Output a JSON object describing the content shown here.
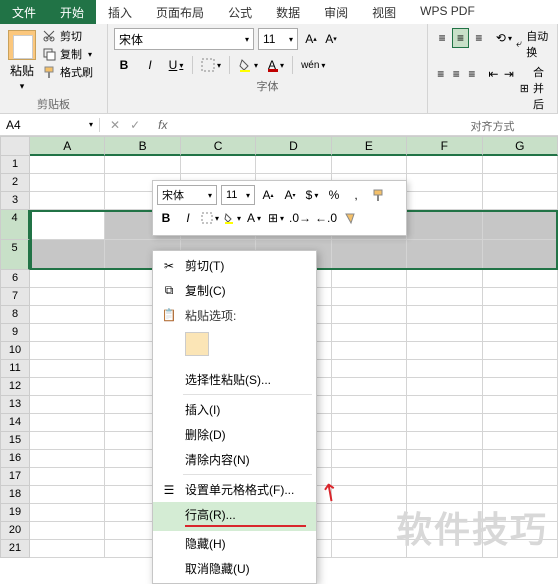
{
  "tabs": {
    "file": "文件",
    "home": "开始",
    "insert": "插入",
    "layout": "页面布局",
    "formula": "公式",
    "data": "数据",
    "review": "审阅",
    "view": "视图",
    "wps": "WPS PDF"
  },
  "clipboard": {
    "paste": "粘贴",
    "cut": "剪切",
    "copy": "复制",
    "format_painter": "格式刷",
    "group": "剪贴板"
  },
  "font": {
    "name": "宋体",
    "size": "11",
    "bold": "B",
    "italic": "I",
    "underline": "U",
    "wen": "wén",
    "group": "字体"
  },
  "align": {
    "auto_wrap": "自动换",
    "merge": "合并后",
    "group": "对齐方式"
  },
  "namebox": "A4",
  "columns": [
    "A",
    "B",
    "C",
    "D",
    "E",
    "F",
    "G"
  ],
  "rows": [
    "1",
    "2",
    "3",
    "4",
    "5",
    "6",
    "7",
    "8",
    "9",
    "10",
    "11",
    "12",
    "13",
    "14",
    "15",
    "16",
    "17",
    "18",
    "19",
    "20",
    "21"
  ],
  "mini": {
    "font": "宋体",
    "size": "11",
    "bold": "B",
    "italic": "I",
    "percent": "%",
    "comma": ","
  },
  "menu": {
    "cut": "剪切(T)",
    "copy": "复制(C)",
    "paste_options": "粘贴选项:",
    "paste_special": "选择性粘贴(S)...",
    "insert": "插入(I)",
    "delete": "删除(D)",
    "clear": "清除内容(N)",
    "format_cells": "设置单元格格式(F)...",
    "row_height": "行高(R)...",
    "hide": "隐藏(H)",
    "unhide": "取消隐藏(U)"
  },
  "watermark": "软件技巧"
}
